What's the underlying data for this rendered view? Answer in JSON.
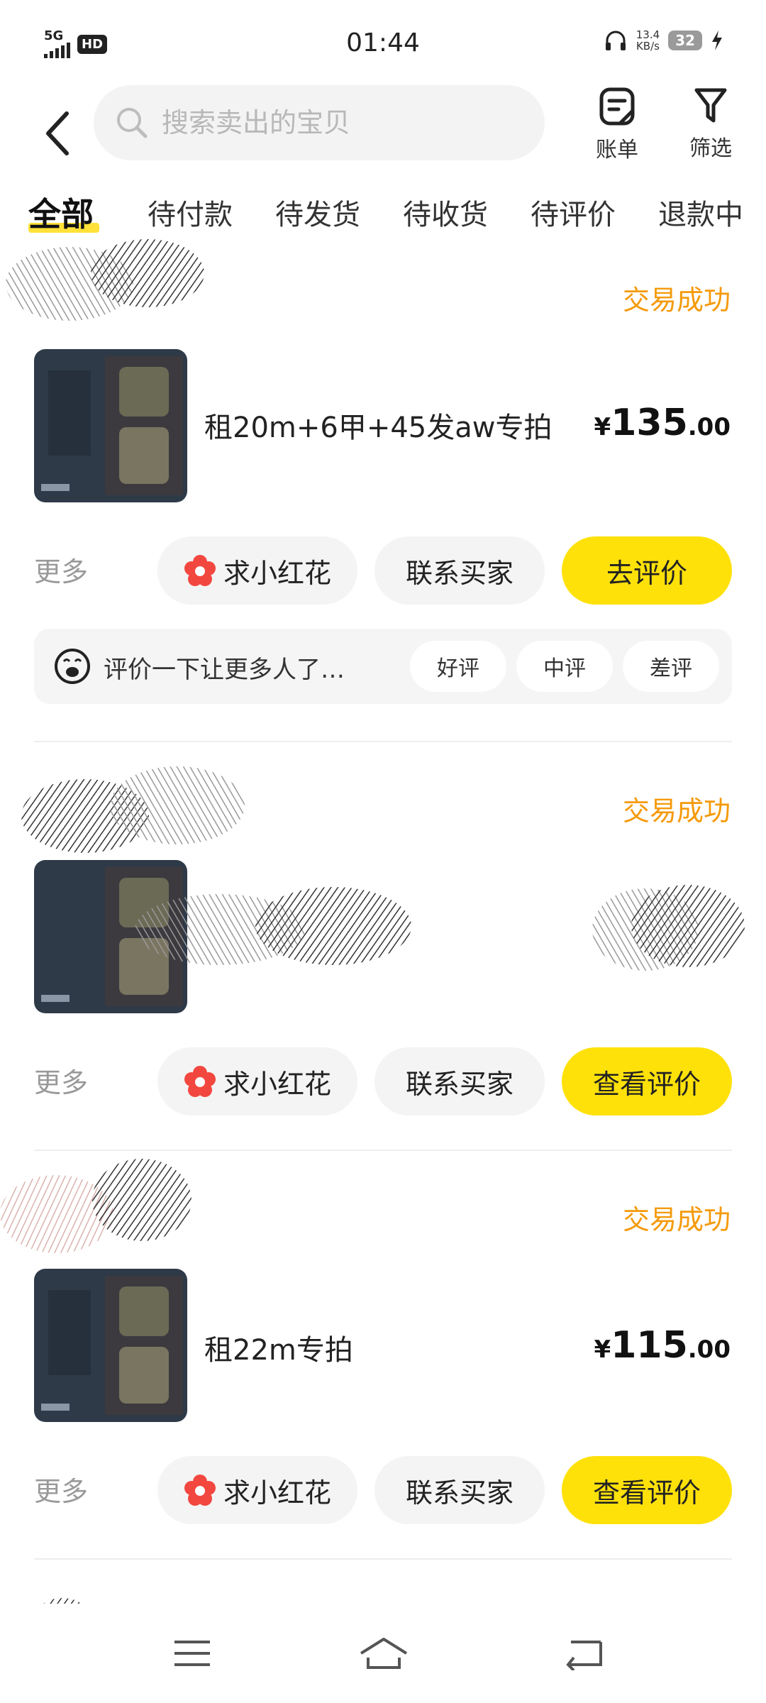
{
  "status_bar": {
    "network": "5G",
    "hd": "HD",
    "time": "01:44",
    "speed_value": "13.4",
    "speed_unit": "KB/s",
    "battery": "32"
  },
  "header": {
    "search_placeholder": "搜索卖出的宝贝",
    "bill_label": "账单",
    "filter_label": "筛选"
  },
  "tabs": [
    "全部",
    "待付款",
    "待发货",
    "待收货",
    "待评价",
    "退款中"
  ],
  "colors": {
    "accent_yellow": "#ffe10a",
    "status_orange": "#f59a0b",
    "flower_red": "#f2473f"
  },
  "orders": [
    {
      "status": "交易成功",
      "title": "租20m+6甲+45发aw专拍",
      "price_currency": "¥",
      "price_int": "135",
      "price_dec": ".00",
      "more": "更多",
      "btn_flower": "求小红花",
      "btn_contact": "联系买家",
      "btn_primary": "去评价",
      "review_prompt": "评价一下让更多人了…",
      "review_good": "好评",
      "review_mid": "中评",
      "review_bad": "差评"
    },
    {
      "status": "交易成功",
      "more": "更多",
      "btn_flower": "求小红花",
      "btn_contact": "联系买家",
      "btn_primary": "查看评价"
    },
    {
      "status": "交易成功",
      "title": "租22m专拍",
      "price_currency": "¥",
      "price_int": "115",
      "price_dec": ".00",
      "more": "更多",
      "btn_flower": "求小红花",
      "btn_contact": "联系买家",
      "btn_primary": "查看评价"
    }
  ],
  "icons": {
    "back": "chevron-left-icon",
    "search": "search-icon",
    "bill": "bill-icon",
    "filter": "filter-icon",
    "flower": "flower-icon",
    "review_face": "emoji-face-icon",
    "nav_menu": "menu-icon",
    "nav_home": "home-icon",
    "nav_back": "back-arrow-icon"
  }
}
